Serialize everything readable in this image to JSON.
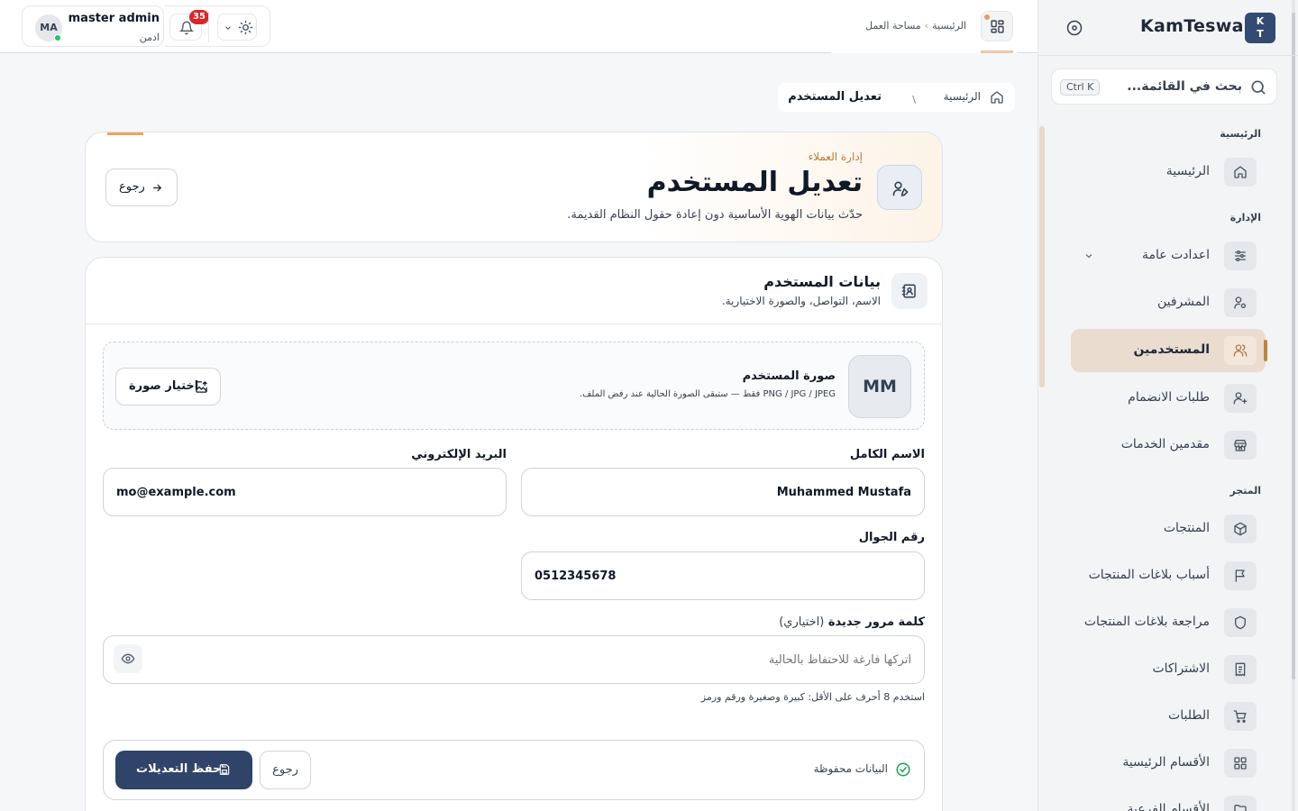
{
  "sidebar": {
    "logo_text": "K\nT",
    "brand": "KamTeswa",
    "search_placeholder": "بحث في القائمة...",
    "search_shortcut": "Ctrl K",
    "sections": {
      "home": "الرئيسية",
      "admin": "الإدارة",
      "store": "المتجر"
    },
    "items": [
      {
        "label": "الرئيسية",
        "icon": "home-icon"
      },
      {
        "label": "اعدادت عامة",
        "icon": "sliders-icon"
      },
      {
        "label": "المشرفين",
        "icon": "user-cog-icon"
      },
      {
        "label": "المستخدمين",
        "icon": "users-icon",
        "active": true
      },
      {
        "label": "طلبات الانضمام",
        "icon": "user-plus-icon"
      },
      {
        "label": "مقدمين الخدمات",
        "icon": "store-icon"
      },
      {
        "label": "المنتجات",
        "icon": "box-icon"
      },
      {
        "label": "أسباب بلاغات المنتجات",
        "icon": "flag-icon"
      },
      {
        "label": "مراجعة بلاغات المنتجات",
        "icon": "shield-icon"
      },
      {
        "label": "الاشتراكات",
        "icon": "receipt-icon"
      },
      {
        "label": "الطلبات",
        "icon": "cart-icon"
      },
      {
        "label": "الأقسام الرئيسية",
        "icon": "grid-icon"
      },
      {
        "label": "الأقسام الفرعية",
        "icon": "folder-icon"
      }
    ]
  },
  "topbar": {
    "user_initials": "MA",
    "user_name": "master admin",
    "user_role": "ادمن",
    "notification_count": "35",
    "workspace_crumb_home": "الرئيسية",
    "workspace_crumb_current": "مساحة العمل"
  },
  "breadcrumb": {
    "home": "الرئيسية",
    "separator": "\\",
    "current": "تعديل المستخدم"
  },
  "hero": {
    "kicker": "إدارة العملاء",
    "title": "تعديل المستخدم",
    "subtitle": "حدّث بيانات الهوية الأساسية دون إعادة حقول النظام القديمة.",
    "back_label": "رجوع"
  },
  "form": {
    "section_title": "بيانات المستخدم",
    "section_subtitle": "الاسم، التواصل، والصورة الاختيارية.",
    "photo": {
      "initials": "MM",
      "title": "صورة المستخدم",
      "help": "PNG / JPG / JPEG فقط — ستبقى الصورة الحالية عند رفض الملف.",
      "button": "اختيار صورة"
    },
    "full_name": {
      "label": "الاسم الكامل",
      "value": "Muhammed Mustafa"
    },
    "email": {
      "label": "البريد الإلكتروني",
      "value": "mo@example.com"
    },
    "phone": {
      "label": "رقم الجوال",
      "value": "0512345678"
    },
    "password": {
      "label": "كلمة مرور جديدة",
      "label_optional": "(اختياري)",
      "placeholder": "اتركها فارغة للاحتفاظ بالحالية",
      "hint": "استخدم 8 أحرف على الأقل: كبيرة وصغيرة ورقم ورمز"
    },
    "footer": {
      "status": "البيانات محفوظة",
      "cancel": "رجوع",
      "save": "حفظ التعديلات"
    }
  }
}
